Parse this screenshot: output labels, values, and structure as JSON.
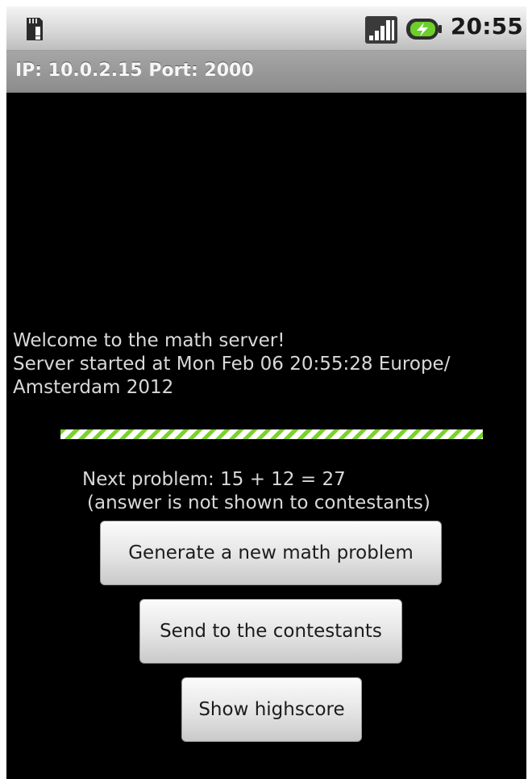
{
  "status_bar": {
    "time": "20:55",
    "icons": [
      "sd-card-warning-icon",
      "signal-icon",
      "battery-charging-icon"
    ]
  },
  "title_bar": {
    "text": "IP: 10.0.2.15 Port: 2000"
  },
  "welcome": {
    "line1": "Welcome to the math server!",
    "line2": "Server started at Mon Feb 06 20:55:28 Europe/",
    "line3": "Amsterdam 2012"
  },
  "progress": {
    "value": 1.0,
    "colors": {
      "stripe": "#7bd12e",
      "background": "#ffffff"
    }
  },
  "problem": {
    "text": "Next problem: 15 + 12 = 27",
    "note": "(answer is not shown to contestants)"
  },
  "buttons": {
    "generate": "Generate a new math problem",
    "send": "Send to the contestants",
    "highscore": "Show highscore"
  },
  "colors": {
    "background": "#000000",
    "text": "#d9d9d9",
    "title_bar": "#999999"
  }
}
